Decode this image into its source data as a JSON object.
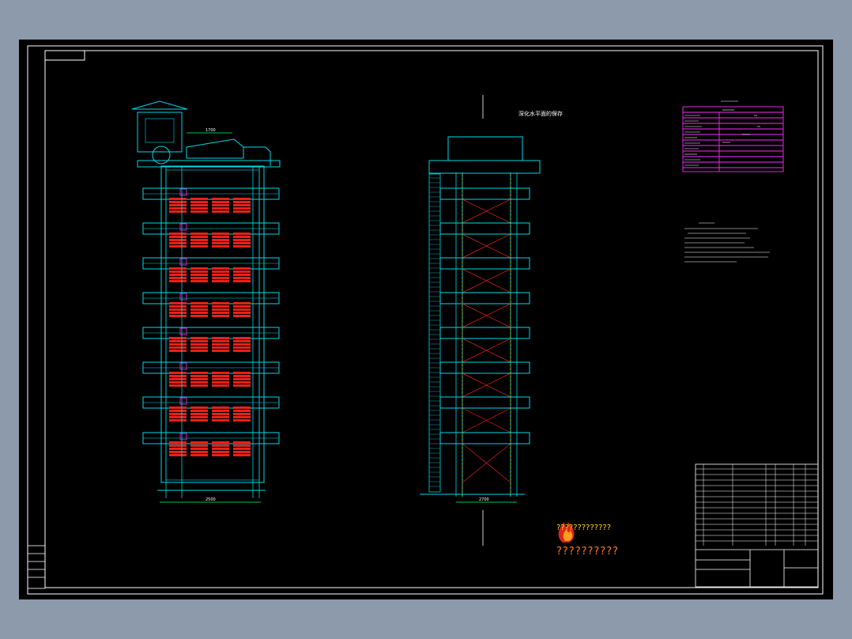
{
  "drawing": {
    "dimension_left_bottom": "2500",
    "dimension_right_bottom": "2700",
    "dimension_left_top": "1700",
    "right_view_caption": "深化水平面的保存",
    "tech_requirements_title": "技术要求"
  },
  "watermark": {
    "line1": "??????????",
    "line2": "?????????????"
  },
  "colors": {
    "background": "#000000",
    "frame": "#ffffff",
    "structure": "#00d8e8",
    "heater": "#e8201a",
    "annotation": "#ff2aff",
    "dimension": "#00ff66",
    "text": "#ffffff"
  },
  "icons": {
    "logo": "flame-logo-icon"
  }
}
